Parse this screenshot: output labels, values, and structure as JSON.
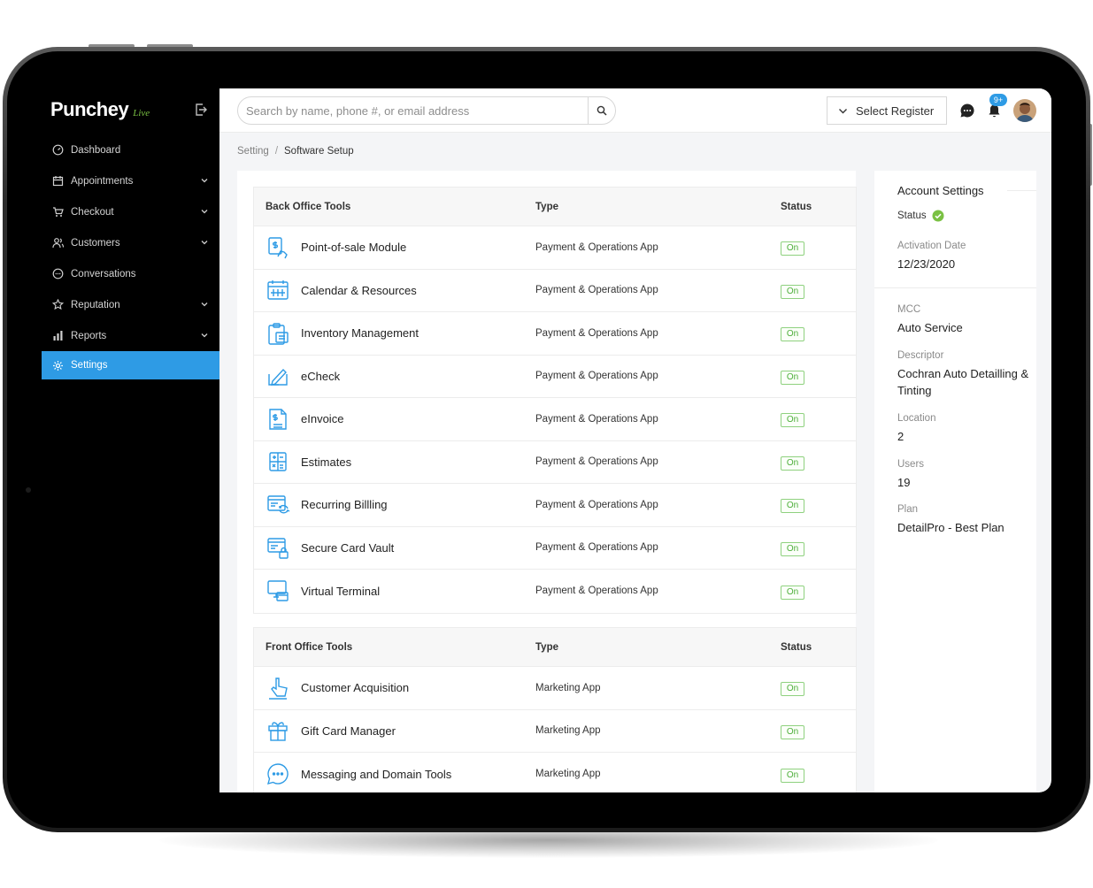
{
  "app": {
    "logo_name": "Punchey",
    "logo_suffix": "Live"
  },
  "sidebar": {
    "items": [
      {
        "label": "Dashboard",
        "icon": "dashboard-icon",
        "has_submenu": false,
        "active": false
      },
      {
        "label": "Appointments",
        "icon": "calendar-icon",
        "has_submenu": true,
        "active": false
      },
      {
        "label": "Checkout",
        "icon": "cart-icon",
        "has_submenu": true,
        "active": false
      },
      {
        "label": "Customers",
        "icon": "users-icon",
        "has_submenu": true,
        "active": false
      },
      {
        "label": "Conversations",
        "icon": "chat-bubble-icon",
        "has_submenu": false,
        "active": false
      },
      {
        "label": "Reputation",
        "icon": "star-icon",
        "has_submenu": true,
        "active": false
      },
      {
        "label": "Reports",
        "icon": "bar-chart-icon",
        "has_submenu": true,
        "active": false
      },
      {
        "label": "Settings",
        "icon": "gear-icon",
        "has_submenu": false,
        "active": true
      }
    ]
  },
  "header": {
    "search_placeholder": "Search by name, phone #, or email address",
    "search_value": "",
    "register_label": "Select Register",
    "notification_count": "9+"
  },
  "breadcrumb": {
    "parent": "Setting",
    "separator": "/",
    "current": "Software Setup"
  },
  "back_office": {
    "headers": {
      "name": "Back Office Tools",
      "type": "Type",
      "status": "Status"
    },
    "rows": [
      {
        "name": "Point-of-sale Module",
        "type": "Payment & Operations App",
        "status": "On",
        "icon": "pos-terminal-icon"
      },
      {
        "name": "Calendar & Resources",
        "type": "Payment & Operations App",
        "status": "On",
        "icon": "calendar-grid-icon"
      },
      {
        "name": "Inventory Management",
        "type": "Payment & Operations App",
        "status": "On",
        "icon": "clipboard-list-icon"
      },
      {
        "name": "eCheck",
        "type": "Payment & Operations App",
        "status": "On",
        "icon": "check-sign-icon"
      },
      {
        "name": "eInvoice",
        "type": "Payment & Operations App",
        "status": "On",
        "icon": "invoice-icon"
      },
      {
        "name": "Estimates",
        "type": "Payment & Operations App",
        "status": "On",
        "icon": "calculator-icon"
      },
      {
        "name": "Recurring Billling",
        "type": "Payment & Operations App",
        "status": "On",
        "icon": "recurring-billing-icon"
      },
      {
        "name": "Secure Card Vault",
        "type": "Payment & Operations App",
        "status": "On",
        "icon": "card-lock-icon"
      },
      {
        "name": "Virtual Terminal",
        "type": "Payment & Operations App",
        "status": "On",
        "icon": "monitor-card-icon"
      }
    ]
  },
  "front_office": {
    "headers": {
      "name": "Front Office Tools",
      "type": "Type",
      "status": "Status"
    },
    "rows": [
      {
        "name": "Customer Acquisition",
        "type": "Marketing App",
        "status": "On",
        "icon": "hand-point-icon"
      },
      {
        "name": "Gift Card Manager",
        "type": "Marketing App",
        "status": "On",
        "icon": "gift-icon"
      },
      {
        "name": "Messaging and Domain Tools",
        "type": "Marketing App",
        "status": "On",
        "icon": "message-dots-icon"
      }
    ]
  },
  "account": {
    "title": "Account Settings",
    "status_label": "Status",
    "status_color": "#7ac143",
    "activation_label": "Activation Date",
    "activation_value": "12/23/2020",
    "mcc_label": "MCC",
    "mcc_value": "Auto Service",
    "descriptor_label": "Descriptor",
    "descriptor_value": "Cochran Auto Detailling & Tinting",
    "location_label": "Location",
    "location_value": "2",
    "users_label": "Users",
    "users_value": "19",
    "plan_label": "Plan",
    "plan_value": "DetailPro - Best Plan"
  },
  "colors": {
    "accent": "#2e9be5",
    "status_green": "#4dae3a",
    "icon_blue": "#2e9be5"
  }
}
